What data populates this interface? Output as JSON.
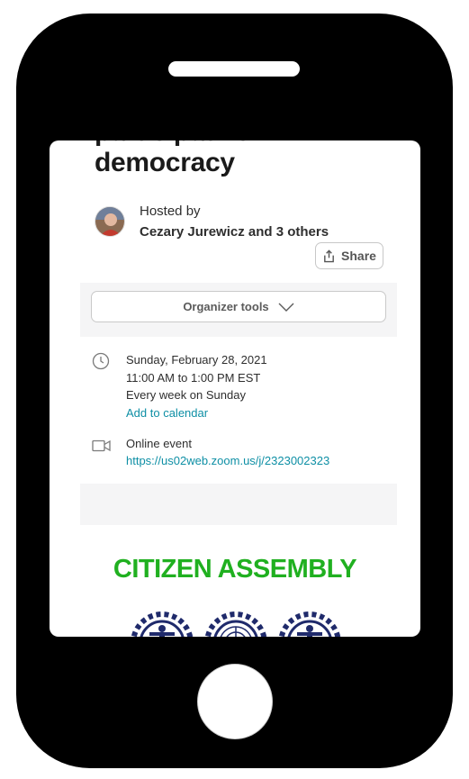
{
  "event": {
    "title_lines": [
      "participative",
      "democracy"
    ],
    "hosted_by_label": "Hosted by",
    "host_names": "Cezary Jurewicz and 3 others",
    "share_label": "Share",
    "organizer_tools_label": "Organizer tools",
    "date": "Sunday, February 28, 2021",
    "time": "11:00 AM to 1:00 PM EST",
    "recurrence": "Every week on Sunday",
    "add_to_calendar": "Add to calendar",
    "location_type": "Online event",
    "online_link": "https://us02web.zoom.us/j/2323002323"
  },
  "banner": {
    "title": "CITIZEN ASSEMBLY",
    "title_color": "#20b020",
    "gear_color": "#1f2a6b"
  },
  "colors": {
    "link": "#0e8fa5",
    "text": "#2e2e2e",
    "phone_frame": "#000000"
  },
  "icons": {
    "date": "clock-icon",
    "location": "video-camera-icon",
    "share": "share-icon",
    "dropdown": "chevron-down-icon"
  }
}
